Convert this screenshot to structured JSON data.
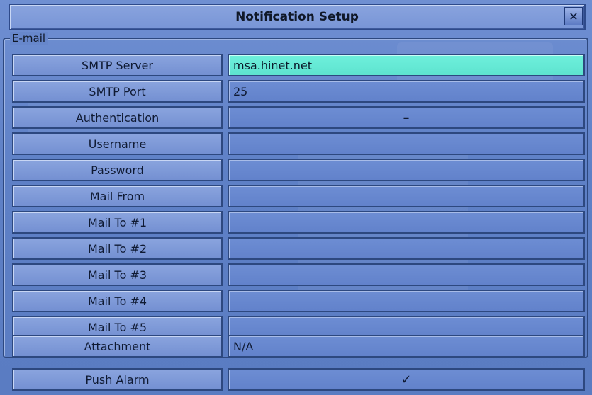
{
  "window": {
    "title": "Notification Setup",
    "close_icon": "close-icon"
  },
  "section": {
    "legend": "E-mail"
  },
  "fields": [
    {
      "label": "SMTP Server",
      "value": "msa.hinet.net"
    },
    {
      "label": "SMTP Port",
      "value": "25"
    },
    {
      "label": "Authentication",
      "value": "–"
    },
    {
      "label": "Username",
      "value": ""
    },
    {
      "label": "Password",
      "value": ""
    },
    {
      "label": "Mail From",
      "value": ""
    },
    {
      "label": "Mail To #1",
      "value": ""
    },
    {
      "label": "Mail To #2",
      "value": ""
    },
    {
      "label": "Mail To #3",
      "value": ""
    },
    {
      "label": "Mail To #4",
      "value": ""
    },
    {
      "label": "Mail To #5",
      "value": ""
    },
    {
      "label": "Attachment",
      "value": "N/A"
    }
  ],
  "push_alarm": {
    "label": "Push Alarm",
    "value": "✓"
  },
  "colors": {
    "selected": "#6ef0dc",
    "panel": "#6787cb",
    "border": "#2d487f"
  }
}
